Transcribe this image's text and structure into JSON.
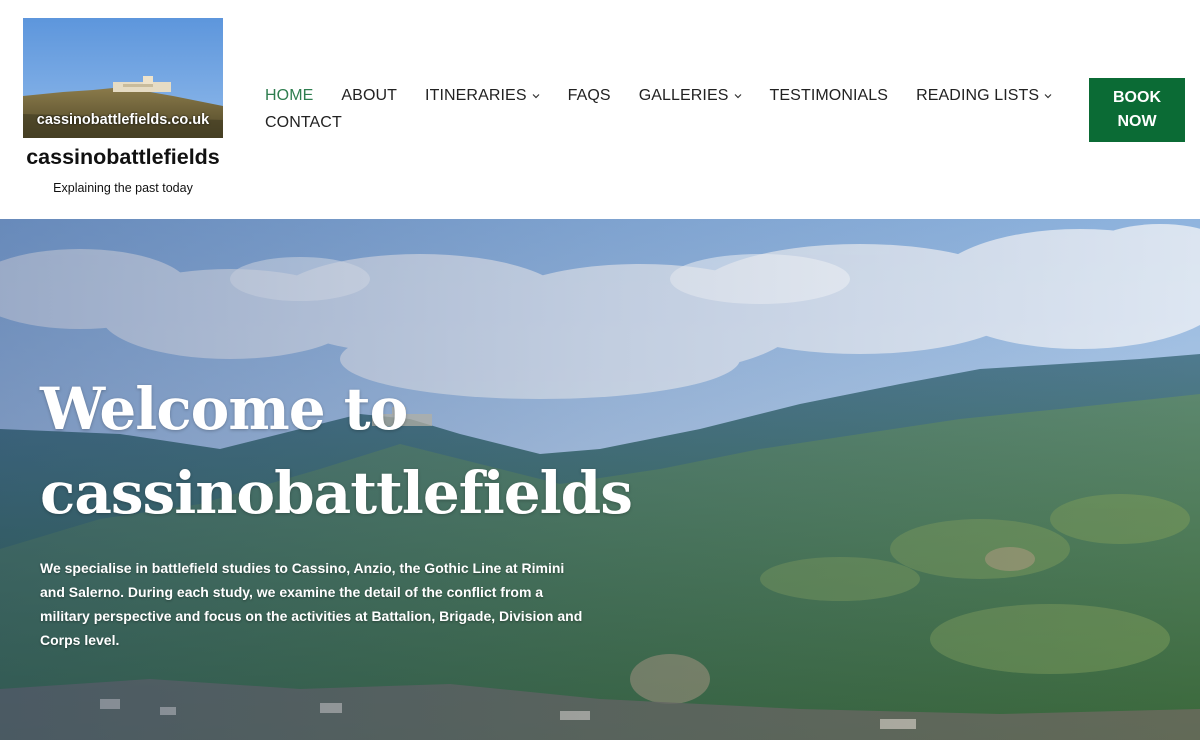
{
  "site": {
    "logo_caption": "cassinobattlefields.co.uk",
    "title": "cassinobattlefields",
    "tagline": "Explaining the past today"
  },
  "nav": {
    "items": [
      {
        "label": "HOME",
        "active": true
      },
      {
        "label": "ABOUT"
      },
      {
        "label": "ITINERARIES",
        "dropdown": true
      },
      {
        "label": "FAQS"
      },
      {
        "label": "GALLERIES",
        "dropdown": true
      },
      {
        "label": "TESTIMONIALS"
      },
      {
        "label": "READING LISTS",
        "dropdown": true
      },
      {
        "label": "CONTACT"
      }
    ],
    "book_line1": "BOOK",
    "book_line2": "NOW"
  },
  "hero": {
    "title_line1": "Welcome to",
    "title_line2": "cassinobattlefields",
    "text": "We specialise in battlefield studies to Cassino, Anzio, the Gothic Line at Rimini and Salerno.  During each study, we examine the detail of the conflict from a military perspective and focus on the activities at Battalion, Brigade, Division and Corps level."
  },
  "colors": {
    "accent": "#0b6b35",
    "active_nav": "#2e7d4f"
  }
}
